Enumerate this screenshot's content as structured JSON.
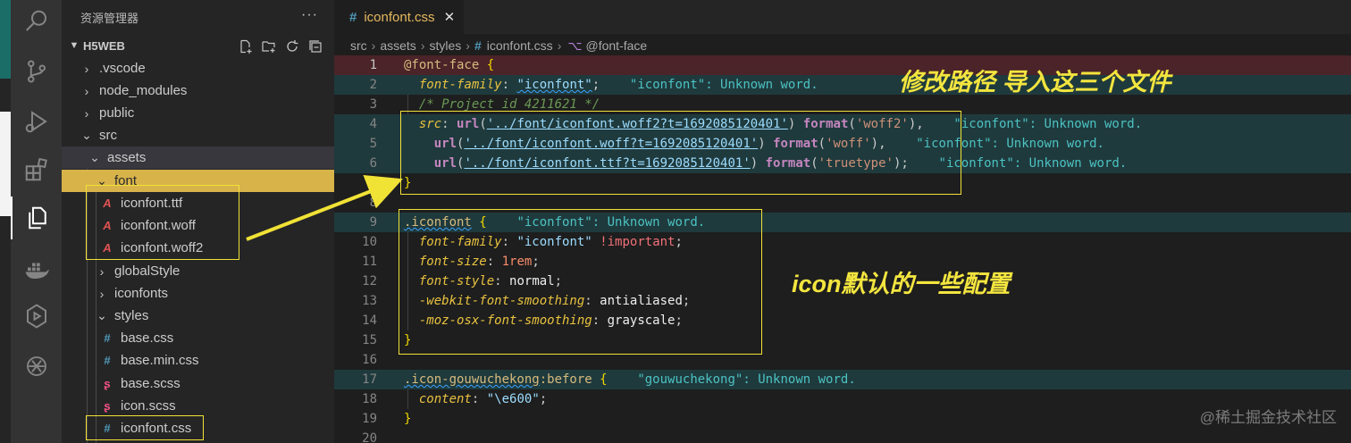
{
  "sidebar": {
    "title": "资源管理器",
    "more": "···",
    "project": "H5WEB",
    "items": [
      {
        "label": ".vscode",
        "type": "folder",
        "open": false
      },
      {
        "label": "node_modules",
        "type": "folder",
        "open": false
      },
      {
        "label": "public",
        "type": "folder",
        "open": false
      },
      {
        "label": "src",
        "type": "folder",
        "open": true
      },
      {
        "label": "assets",
        "type": "folder",
        "open": true
      },
      {
        "label": "font",
        "type": "folder",
        "open": true
      },
      {
        "label": "iconfont.ttf",
        "type": "font-file"
      },
      {
        "label": "iconfont.woff",
        "type": "font-file"
      },
      {
        "label": "iconfont.woff2",
        "type": "font-file"
      },
      {
        "label": "globalStyle",
        "type": "folder",
        "open": false
      },
      {
        "label": "iconfonts",
        "type": "folder",
        "open": false
      },
      {
        "label": "styles",
        "type": "folder",
        "open": true
      },
      {
        "label": "base.css",
        "type": "css-file"
      },
      {
        "label": "base.min.css",
        "type": "css-file"
      },
      {
        "label": "base.scss",
        "type": "scss-file"
      },
      {
        "label": "icon.scss",
        "type": "scss-file"
      },
      {
        "label": "iconfont.css",
        "type": "css-file"
      }
    ]
  },
  "tab": {
    "label": "iconfont.css",
    "close": "✕"
  },
  "breadcrumb": {
    "p1": "src",
    "p2": "assets",
    "p3": "styles",
    "file": "iconfont.css",
    "symbol": "@font-face"
  },
  "lines": {
    "l1": {
      "n": "1",
      "sel": "@font-face",
      "b": "{"
    },
    "l2": {
      "n": "2",
      "prop": "font-family",
      "c": ":",
      "v": "\"iconfont\"",
      "s": ";",
      "diag": "\"iconfont\": Unknown word."
    },
    "l3": {
      "n": "3",
      "cmt": "/* Project id 4211621 */"
    },
    "l4": {
      "n": "4",
      "prop": "src",
      "c": ":",
      "fn": "url",
      "arg": "'../font/iconfont.woff2?t=1692085120401'",
      "fmt": "format",
      "farg": "'woff2'",
      "end": "),",
      "diag": "\"iconfont\": Unknown word."
    },
    "l5": {
      "n": "5",
      "fn": "url",
      "arg": "'../font/iconfont.woff?t=1692085120401'",
      "fmt": "format",
      "farg": "'woff'",
      "end": "),",
      "diag": "\"iconfont\": Unknown word."
    },
    "l6": {
      "n": "6",
      "fn": "url",
      "arg": "'../font/iconfont.ttf?t=1692085120401'",
      "fmt": "format",
      "farg": "'truetype'",
      "end": ");",
      "diag": "\"iconfont\": Unknown word."
    },
    "l7": {
      "n": "7",
      "b": "}"
    },
    "l8": {
      "n": "8"
    },
    "l9": {
      "n": "9",
      "sel": ".iconfont",
      "b": "{",
      "diag": "\"iconfont\": Unknown word."
    },
    "l10": {
      "n": "10",
      "prop": "font-family",
      "c": ":",
      "v": "\"iconfont\"",
      "imp": "!important",
      "s": ";"
    },
    "l11": {
      "n": "11",
      "prop": "font-size",
      "c": ":",
      "v": "1rem",
      "s": ";"
    },
    "l12": {
      "n": "12",
      "prop": "font-style",
      "c": ":",
      "v": "normal",
      "s": ";"
    },
    "l13": {
      "n": "13",
      "prop": "-webkit-font-smoothing",
      "c": ":",
      "v": "antialiased",
      "s": ";"
    },
    "l14": {
      "n": "14",
      "prop": "-moz-osx-font-smoothing",
      "c": ":",
      "v": "grayscale",
      "s": ";"
    },
    "l15": {
      "n": "15",
      "b": "}"
    },
    "l16": {
      "n": "16"
    },
    "l17": {
      "n": "17",
      "sel": ".icon-gouwuchekong",
      "pseudo": ":before",
      "b": "{",
      "diag": "\"gouwuchekong\": Unknown word."
    },
    "l18": {
      "n": "18",
      "prop": "content",
      "c": ":",
      "v": "\"\\e600\"",
      "s": ";"
    },
    "l19": {
      "n": "19",
      "b": "}"
    },
    "l20": {
      "n": "20"
    }
  },
  "annotations": {
    "path_note": "修改路径 导入这三个文件",
    "icon_note": "icon默认的一些配置"
  },
  "watermark": "@稀土掘金技术社区",
  "colors": {
    "annotation": "#f3e53f",
    "selected_folder": "#d8b34a",
    "tab_text": "#e6b95e"
  }
}
